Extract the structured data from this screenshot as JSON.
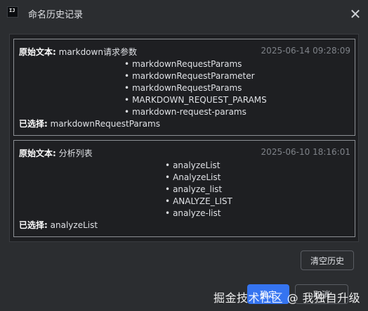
{
  "window": {
    "title": "命名历史记录",
    "app_icon_text": "IJ"
  },
  "history": [
    {
      "original_label": "原始文本:",
      "original_value": "markdown请求参数",
      "timestamp": "2025-06-14 09:28:09",
      "candidates": [
        "markdownRequestParams",
        "markdownRequestParameter",
        "markdownRequestParams",
        "MARKDOWN_REQUEST_PARAMS",
        "markdown-request-params"
      ],
      "selected_label": "已选择:",
      "selected_value": "markdownRequestParams"
    },
    {
      "original_label": "原始文本:",
      "original_value": "分析列表",
      "timestamp": "2025-06-10 18:16:01",
      "candidates": [
        "analyzeList",
        "AnalyzeList",
        "analyze_list",
        "ANALYZE_LIST",
        "analyze-list"
      ],
      "selected_label": "已选择:",
      "selected_value": "analyzeList"
    }
  ],
  "buttons": {
    "clear_history": "清空历史",
    "ok": "确定",
    "cancel": "取消"
  },
  "watermark": "掘金技术社区 @ 我独自升级",
  "colors": {
    "window_bg": "#2b2d30",
    "panel_bg": "#1e1f22",
    "card_border": "#8c8f94",
    "primary_button": "#3574f0",
    "timestamp_text": "#7e8288"
  },
  "icons": {
    "close": "close-icon",
    "app": "intellij-app-icon"
  }
}
